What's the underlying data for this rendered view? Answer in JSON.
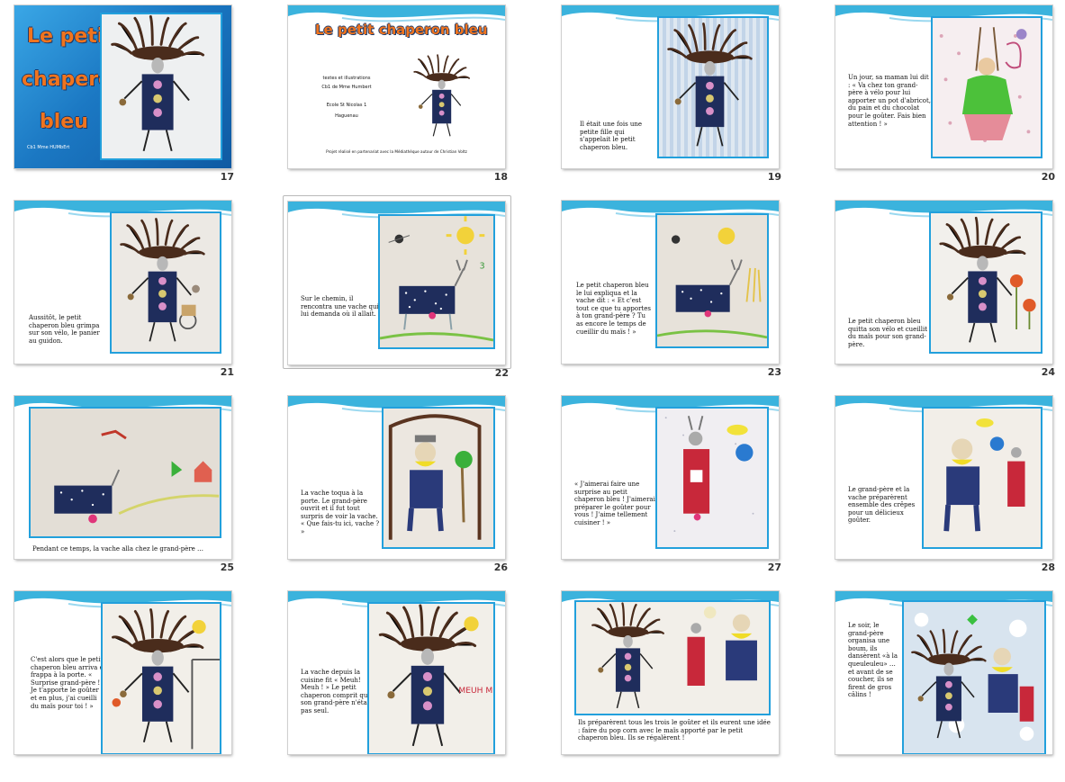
{
  "slides": [
    {
      "num": "17",
      "title_lines": [
        "Le petit",
        "chaperon",
        "bleu"
      ],
      "subtitle": "Cb1 Mme HUMbErt"
    },
    {
      "num": "18",
      "title": "Le petit chaperon bleu",
      "credit_lines": [
        "textes et illustrations",
        "Cb1 de Mme Humbert",
        "Ecole St Nicolas 1",
        "Haguenau"
      ],
      "footer": "Projet réalisé en partenariat avec la Médiathèque  autour de Christian Voltz"
    },
    {
      "num": "19",
      "text": "Il était une fois une petite fille qui s'appelait le petit chaperon bleu."
    },
    {
      "num": "20",
      "text": "Un jour, sa maman lui dit :  « Va chez ton grand-père à vélo pour lui apporter un pot d'abricot, du pain et du chocolat pour le goûter. Fais bien attention ! »"
    },
    {
      "num": "21",
      "text": "Aussitôt, le petit chaperon bleu grimpa sur son vélo, le panier au guidon."
    },
    {
      "num": "22",
      "text": "Sur le chemin, il rencontra une vache qui lui demanda où il allait."
    },
    {
      "num": "23",
      "text": "Le petit chaperon bleu le lui expliqua et la vache dit : « Et c'est tout ce que tu apportes à ton grand-père ? Tu as encore le temps de cueillir du maïs ! »"
    },
    {
      "num": "24",
      "text": "Le petit chaperon bleu quitta son vélo et cueillit du maïs pour son grand-père."
    },
    {
      "num": "25",
      "text": "Pendant ce temps, la vache alla chez le grand-père …"
    },
    {
      "num": "26",
      "text": "La vache toqua à la porte. Le grand-père ouvrit et il fut tout surpris de voir la vache. « Que fais-tu ici, vache ? »"
    },
    {
      "num": "27",
      "text": "« J'aimerai faire une surprise au petit chaperon bleu ! J'aimerai préparer le goûter pour vous ! J'aime tellement cuisiner ! »"
    },
    {
      "num": "28",
      "text": "Le grand-père et la vache préparèrent ensemble des crêpes pour un délicieux goûter."
    },
    {
      "num": "29",
      "text": "C'est alors que le petit chaperon bleu arriva et frappa à la porte. « Surprise grand-père ! Je t'apporte le goûter et en plus, j'ai cueilli du maïs pour toi ! »"
    },
    {
      "num": "30",
      "text": "La vache depuis la cuisine fit « Meuh! Meuh ! » Le petit chaperon comprit que son grand-père n'était pas seul.",
      "sign": "MEUH MEUH !"
    },
    {
      "num": "31",
      "text": "Ils préparèrent tous les trois le goûter et ils eurent une idée : faire du pop corn avec le maïs apporté par le petit chaperon bleu. Ils se régalèrent !"
    },
    {
      "num": "32",
      "text": "Le soir, le grand-père organisa une boum, ils dansèrent «à la queuleuleu» … et avant de se coucher, ils se firent de gros câlins !"
    }
  ],
  "colors": {
    "accent_frame": "#22a0dc",
    "wave": "#3bb3dd",
    "title_orange": "#f0741e",
    "hair": "#4a2c1c",
    "body": "#1f2d5c"
  }
}
